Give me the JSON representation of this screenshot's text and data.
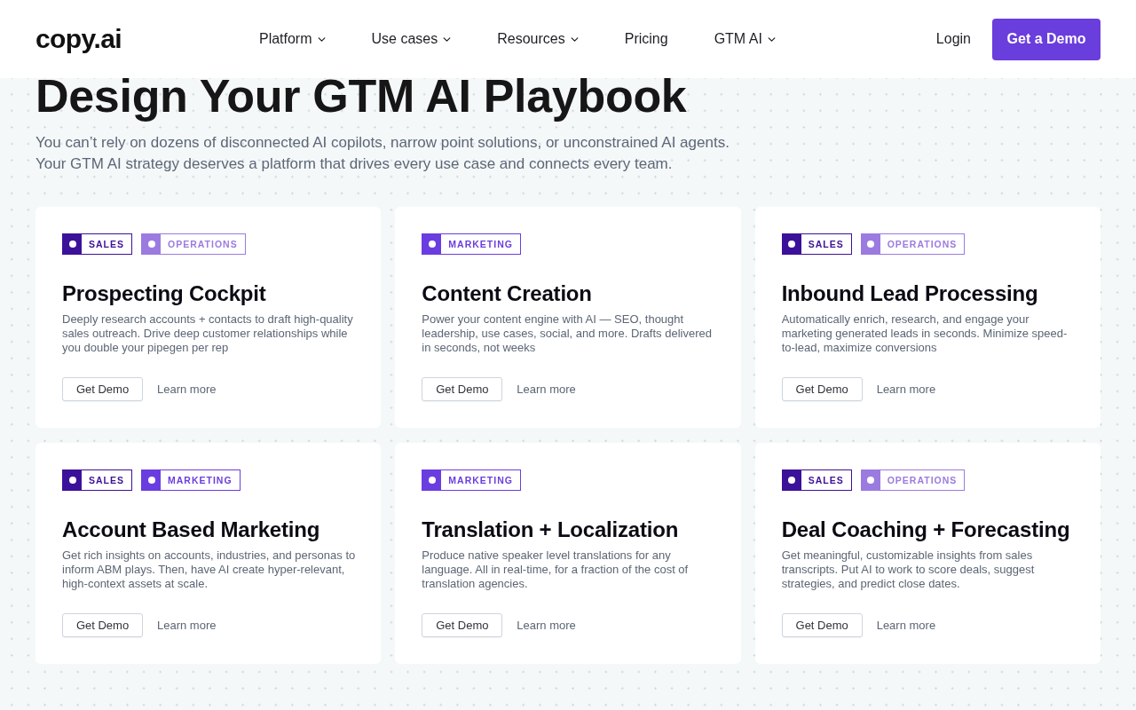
{
  "header": {
    "logo": "copy.ai",
    "nav": [
      {
        "label": "Platform",
        "dropdown": true
      },
      {
        "label": "Use cases",
        "dropdown": true
      },
      {
        "label": "Resources",
        "dropdown": true
      },
      {
        "label": "Pricing",
        "dropdown": false
      },
      {
        "label": "GTM AI",
        "dropdown": true
      }
    ],
    "login": "Login",
    "cta": "Get a Demo"
  },
  "hero": {
    "title": "Design Your GTM AI Playbook",
    "lines": [
      "You can’t rely on dozens of disconnected AI copilots, narrow point solutions, or unconstrained AI agents.",
      "Your GTM AI strategy deserves a platform that drives every use case and connects every team."
    ]
  },
  "cards": [
    {
      "tags": [
        {
          "label": "SALES",
          "color": "#3c1199"
        },
        {
          "label": "OPERATIONS",
          "color": "#9b7be0"
        }
      ],
      "title": "Prospecting Cockpit",
      "description": "Deeply research accounts + contacts to draft high-quality sales outreach. Drive deep customer relationships while you double your pipegen per rep",
      "primary": "Get Demo",
      "secondary": "Learn more"
    },
    {
      "tags": [
        {
          "label": "MARKETING",
          "color": "#6a3de0"
        }
      ],
      "title": "Content Creation",
      "description": "Power your content engine with AI — SEO, thought leadership, use cases, social, and more. Drafts delivered in seconds, not weeks",
      "primary": "Get Demo",
      "secondary": "Learn more"
    },
    {
      "tags": [
        {
          "label": "SALES",
          "color": "#3c1199"
        },
        {
          "label": "OPERATIONS",
          "color": "#9b7be0"
        }
      ],
      "title": "Inbound Lead Processing",
      "description": "Automatically enrich, research, and engage your marketing generated leads in seconds. Minimize speed-to-lead, maximize conversions",
      "primary": "Get Demo",
      "secondary": "Learn more"
    },
    {
      "tags": [
        {
          "label": "SALES",
          "color": "#3c1199"
        },
        {
          "label": "MARKETING",
          "color": "#6a3de0"
        }
      ],
      "title": "Account Based Marketing",
      "description": "Get rich insights on accounts, industries, and personas to inform ABM plays. Then, have AI create hyper-relevant, high-context assets at scale.",
      "primary": "Get Demo",
      "secondary": "Learn more"
    },
    {
      "tags": [
        {
          "label": "MARKETING",
          "color": "#6a3de0"
        }
      ],
      "title": "Translation + Localization",
      "description": "Produce native speaker level translations for any language. All in real-time, for a fraction of the cost of translation agencies.",
      "primary": "Get Demo",
      "secondary": "Learn more"
    },
    {
      "tags": [
        {
          "label": "SALES",
          "color": "#3c1199"
        },
        {
          "label": "OPERATIONS",
          "color": "#9b7be0"
        }
      ],
      "title": "Deal Coaching + Forecasting",
      "description": "Get meaningful, customizable insights from sales transcripts. Put AI to work to score deals, suggest strategies, and predict close dates.",
      "primary": "Get Demo",
      "secondary": "Learn more"
    }
  ]
}
